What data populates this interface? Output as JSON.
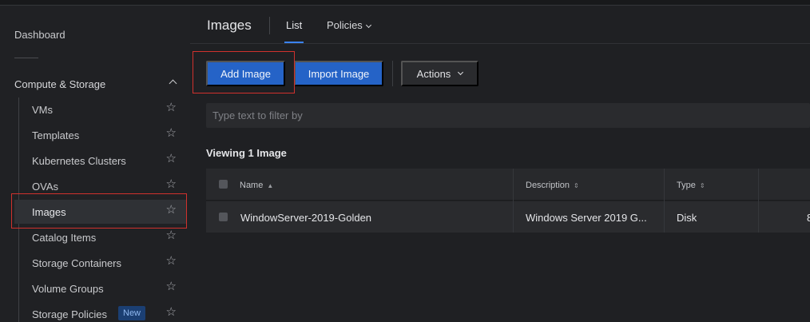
{
  "sidebar": {
    "dashboard_label": "Dashboard",
    "section_title": "Compute & Storage",
    "items": [
      {
        "label": "VMs"
      },
      {
        "label": "Templates"
      },
      {
        "label": "Kubernetes Clusters"
      },
      {
        "label": "OVAs"
      },
      {
        "label": "Images",
        "active": true
      },
      {
        "label": "Catalog Items"
      },
      {
        "label": "Storage Containers"
      },
      {
        "label": "Volume Groups"
      },
      {
        "label": "Storage Policies",
        "badge": "New"
      }
    ],
    "star_icon": "☆"
  },
  "header": {
    "title": "Images",
    "tabs": [
      {
        "label": "List",
        "active": true
      },
      {
        "label": "Policies"
      }
    ]
  },
  "toolbar": {
    "add_label": "Add Image",
    "import_label": "Import Image",
    "actions_label": "Actions"
  },
  "filter": {
    "placeholder": "Type text to filter by",
    "value": ""
  },
  "viewing_text": "Viewing 1 Image",
  "table": {
    "columns": [
      {
        "label": "Name",
        "sort": "▲"
      },
      {
        "label": "Description",
        "sort": "⇕"
      },
      {
        "label": "Type",
        "sort": "⇕"
      }
    ],
    "rows": [
      {
        "name": "WindowServer-2019-Golden",
        "description": "Windows Server 2019 G...",
        "type": "Disk",
        "overflow": "8"
      }
    ]
  },
  "colors": {
    "accent": "#2563c7",
    "highlight": "#d0312d",
    "badge_bg": "#1b3f73"
  }
}
